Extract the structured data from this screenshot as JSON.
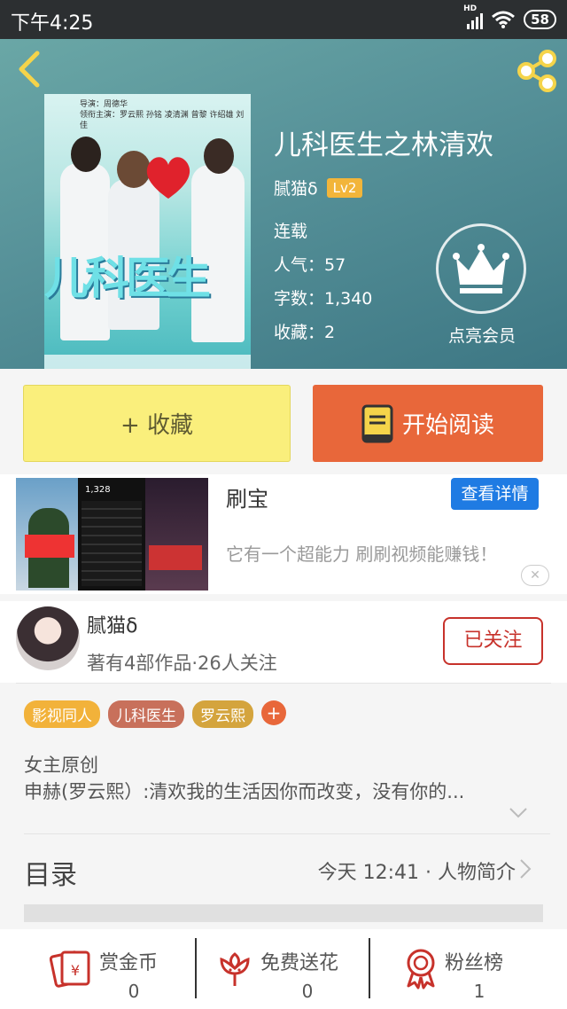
{
  "status_bar": {
    "time": "下午4:25",
    "network": "HD",
    "battery": "58"
  },
  "book": {
    "title": "儿科医生之林清欢",
    "author": "腻猫δ",
    "author_level": "Lv2",
    "status": "连载",
    "popularity": "人气：57",
    "word_count": "字数：1,340",
    "favorites": "收藏：2",
    "vip_label": "点亮会员",
    "cover": {
      "title_text": "儿科医生",
      "credits_line1": "导演：周德华",
      "credits_line2": "领衔主演：罗云熙  孙铭  凌清渊  曾黎  许绍雄  刘佳"
    }
  },
  "actions": {
    "collect_label": "+ 收藏",
    "read_label": "开始阅读"
  },
  "ad": {
    "title": "刷宝",
    "detail_button": "查看详情",
    "description": "它有一个超能力 刷刷视频能赚钱！",
    "close": "✕",
    "thumb_count": "1,328"
  },
  "author_card": {
    "name": "腻猫δ",
    "stats": "著有4部作品·26人关注",
    "follow_label": "已关注"
  },
  "tags": [
    {
      "label": "影视同人",
      "color": "#f2b23a"
    },
    {
      "label": "儿科医生",
      "color": "#c8705b"
    },
    {
      "label": "罗云熙",
      "color": "#d4a43d"
    }
  ],
  "tag_add": "+",
  "intro": {
    "line1": "女主原创",
    "line2": "申赫(罗云熙）:清欢我的生活因你而改变，没有你的..."
  },
  "toc": {
    "label": "目录",
    "info": "今天 12:41 · 人物简介"
  },
  "bottom_bar": {
    "reward": {
      "label": "赏金币",
      "value": "0"
    },
    "flower": {
      "label": "免费送花",
      "value": "0"
    },
    "fans": {
      "label": "粉丝榜",
      "value": "1"
    }
  },
  "colors": {
    "accent_orange": "#e8673a",
    "collect_yellow": "#faef7c",
    "follow_red": "#c7322b",
    "ad_blue": "#1f7be3",
    "icon_red": "#c7322b"
  },
  "icons": [
    "back-arrow-icon",
    "share-icon",
    "crown-icon",
    "book-icon",
    "red-envelope-icon",
    "flower-icon",
    "ribbon-medal-icon",
    "chevron-right-icon",
    "chevron-down-icon",
    "close-icon"
  ]
}
